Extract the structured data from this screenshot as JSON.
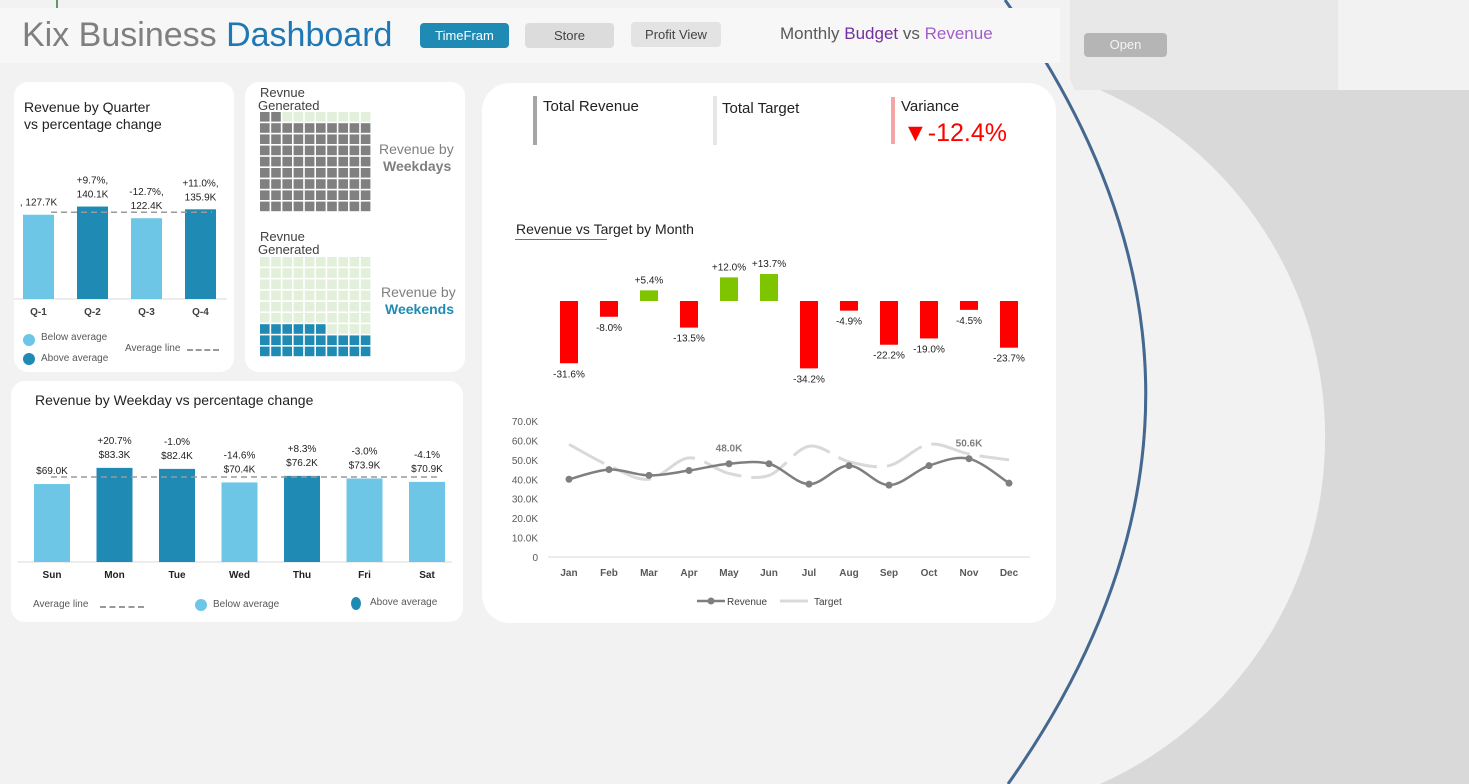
{
  "header": {
    "title_part1": "Kix Business ",
    "title_part2": "Dashboard",
    "buttons": [
      {
        "label": "TimeFram",
        "active": true
      },
      {
        "label": "Store",
        "active": false
      },
      {
        "label": "Profit View",
        "active": false
      }
    ],
    "subtitle_word1": "Monthly ",
    "subtitle_word2": "Budget",
    "subtitle_word3": " vs ",
    "subtitle_word4": "Revenue",
    "open_button": "Open"
  },
  "colors": {
    "light_blue": "#6ec6e6",
    "dark_blue": "#1f8bb4",
    "gray_square": "#808080",
    "light_square": "#e2efda",
    "red": "#ff0000",
    "green": "#7ec500",
    "line_revenue": "#7f7f7f",
    "line_target": "#d9d9d9",
    "accent": "#218dbb"
  },
  "quarter_panel": {
    "title_line1": "Revenue by Quarter",
    "title_line2": "vs percentage change",
    "legend_below": "Below average",
    "legend_above": "Above average",
    "legend_avg": "Average line"
  },
  "waffle_panel": {
    "top_label_line1": "Revnue",
    "top_label_line2": "Generated",
    "top_caption_line1": "Revenue by",
    "top_caption_line2": "Weekdays",
    "top_filled_squares": 82,
    "bottom_label_line1": "Revnue",
    "bottom_label_line2": "Generated",
    "bottom_caption_line1": "Revenue by",
    "bottom_caption_line2": "Weekends",
    "bottom_filled_squares": 26
  },
  "weekday_panel": {
    "title": "Revenue by Weekday vs percentage change",
    "legend_avg": "Average line",
    "legend_below": "Below average",
    "legend_above": "Above average"
  },
  "kpis": [
    {
      "label": "Total Revenue",
      "value": ""
    },
    {
      "label": "Total Target",
      "value": ""
    },
    {
      "label": "Variance",
      "value": "-12.4%"
    }
  ],
  "variance_arrow": "▼",
  "chart_data": [
    {
      "type": "bar",
      "title": "Revenue by Quarter vs percentage change",
      "categories": [
        "Q-1",
        "Q-2",
        "Q-3",
        "Q-4"
      ],
      "values": [
        127.7,
        140.1,
        122.4,
        135.9
      ],
      "labels_line1": [
        ", 127.7K",
        "+9.7%,",
        "-12.7%,",
        "+11.0%,"
      ],
      "labels_line2": [
        "",
        "140.1K",
        "122.4K",
        "135.9K"
      ],
      "above_average": [
        false,
        true,
        false,
        true
      ],
      "average": 131.5,
      "ylim": [
        0,
        185
      ]
    },
    {
      "type": "bar",
      "title": "Revenue by Weekday vs percentage change",
      "categories": [
        "Sun",
        "Mon",
        "Tue",
        "Wed",
        "Thu",
        "Fri",
        "Sat"
      ],
      "values": [
        69.0,
        83.3,
        82.4,
        70.4,
        76.2,
        73.9,
        70.9
      ],
      "labels_line1": [
        "",
        "+20.7%",
        "-1.0%",
        "-14.6%",
        "+8.3%",
        "-3.0%",
        "-4.1%"
      ],
      "labels_line2": [
        "$69.0K",
        "$83.3K",
        "$82.4K",
        "$70.4K",
        "$76.2K",
        "$73.9K",
        "$70.9K"
      ],
      "above_average": [
        false,
        true,
        true,
        false,
        true,
        false,
        false
      ],
      "average": 75.2,
      "ylim": [
        0,
        115
      ]
    },
    {
      "type": "bar",
      "title": "Revenue vs Target by Month",
      "categories": [
        "Jan",
        "Feb",
        "Mar",
        "Apr",
        "May",
        "Jun",
        "Jul",
        "Aug",
        "Sep",
        "Oct",
        "Nov",
        "Dec"
      ],
      "values": [
        -31.6,
        -8.0,
        5.4,
        -13.5,
        12.0,
        13.7,
        -34.2,
        -4.9,
        -22.2,
        -19.0,
        -4.5,
        -23.7
      ],
      "labels": [
        "-31.6%",
        "-8.0%",
        "+5.4%",
        "-13.5%",
        "+12.0%",
        "+13.7%",
        "-34.2%",
        "-4.9%",
        "-22.2%",
        "-19.0%",
        "-4.5%",
        "-23.7%"
      ]
    },
    {
      "type": "line",
      "categories": [
        "Jan",
        "Feb",
        "Mar",
        "Apr",
        "May",
        "Jun",
        "Jul",
        "Aug",
        "Sep",
        "Oct",
        "Nov",
        "Dec"
      ],
      "y_ticks": [
        "0",
        "10.0K",
        "20.0K",
        "30.0K",
        "40.0K",
        "50.0K",
        "60.0K",
        "70.0K"
      ],
      "ylim": [
        0,
        70
      ],
      "series": [
        {
          "name": "Revenue",
          "values": [
            40,
            45,
            42,
            44.5,
            48,
            48,
            37.5,
            47,
            37,
            47,
            50.6,
            38
          ]
        },
        {
          "name": "Target",
          "values": [
            58,
            47,
            40,
            51,
            43,
            42,
            57,
            49,
            47,
            58,
            53,
            50
          ]
        }
      ],
      "annotations": [
        {
          "index": 4,
          "text": "48.0K"
        },
        {
          "index": 10,
          "text": "50.6K"
        }
      ]
    }
  ]
}
